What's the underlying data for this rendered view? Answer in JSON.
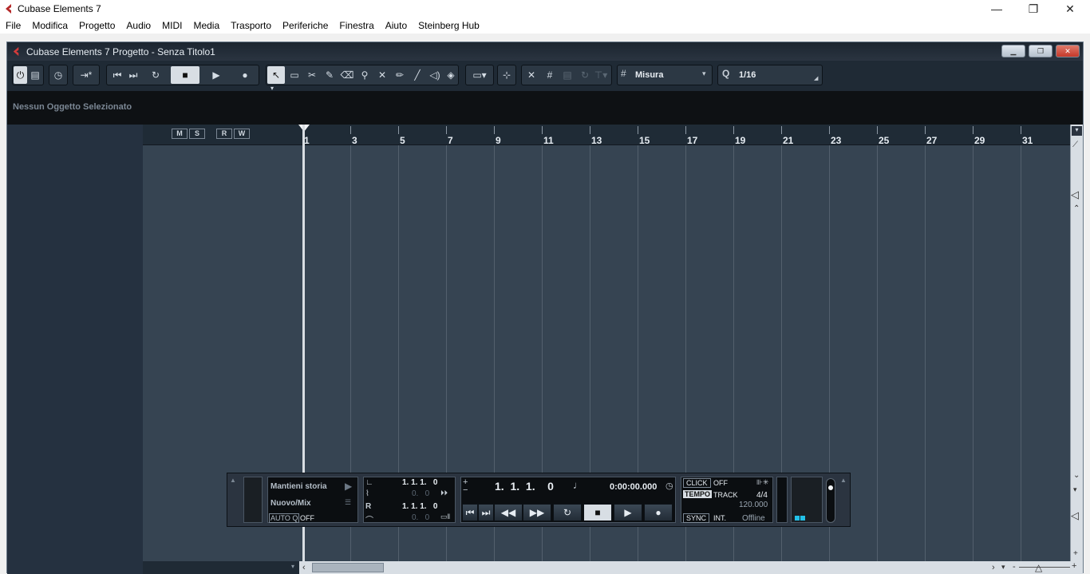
{
  "window": {
    "title": "Cubase Elements 7"
  },
  "menubar": {
    "items": [
      "File",
      "Modifica",
      "Progetto",
      "Audio",
      "MIDI",
      "Media",
      "Trasporto",
      "Periferiche",
      "Finestra",
      "Aiuto",
      "Steinberg Hub"
    ]
  },
  "project": {
    "title": "Cubase Elements 7 Progetto - Senza Titolo1"
  },
  "toolbar": {
    "snap_mode": "Misura",
    "quantize": "1/16"
  },
  "infobar": {
    "text": "Nessun Oggetto Selezionato"
  },
  "ruler": {
    "bars": [
      "1",
      "3",
      "5",
      "7",
      "9",
      "11",
      "13",
      "15",
      "17",
      "19",
      "21",
      "23",
      "25",
      "27",
      "29",
      "31"
    ]
  },
  "track_buttons": [
    "M",
    "S",
    "R",
    "W"
  ],
  "transport": {
    "history_label": "Mantieni storia",
    "mix_label": "Nuovo/Mix",
    "autoq_label": "AUTO Q",
    "autoq_value": "OFF",
    "left_locator": "1. 1. 1.   0",
    "left_sub": "0.   0",
    "right_locator": "1. 1. 1.   0",
    "right_sub": "0.   0",
    "position_bars": "1.  1.  1.    0",
    "position_time": "0:00:00.000",
    "click_label": "CLICK",
    "click_value": "OFF",
    "tempo_label": "TEMPO",
    "tempo_mode": "TRACK",
    "signature": "4/4",
    "bpm": "120.000",
    "sync_label": "SYNC",
    "sync_mode": "INT.",
    "sync_status": "Offline"
  },
  "colors": {
    "accent": "#c0392b",
    "meter": "#22c0e8"
  }
}
